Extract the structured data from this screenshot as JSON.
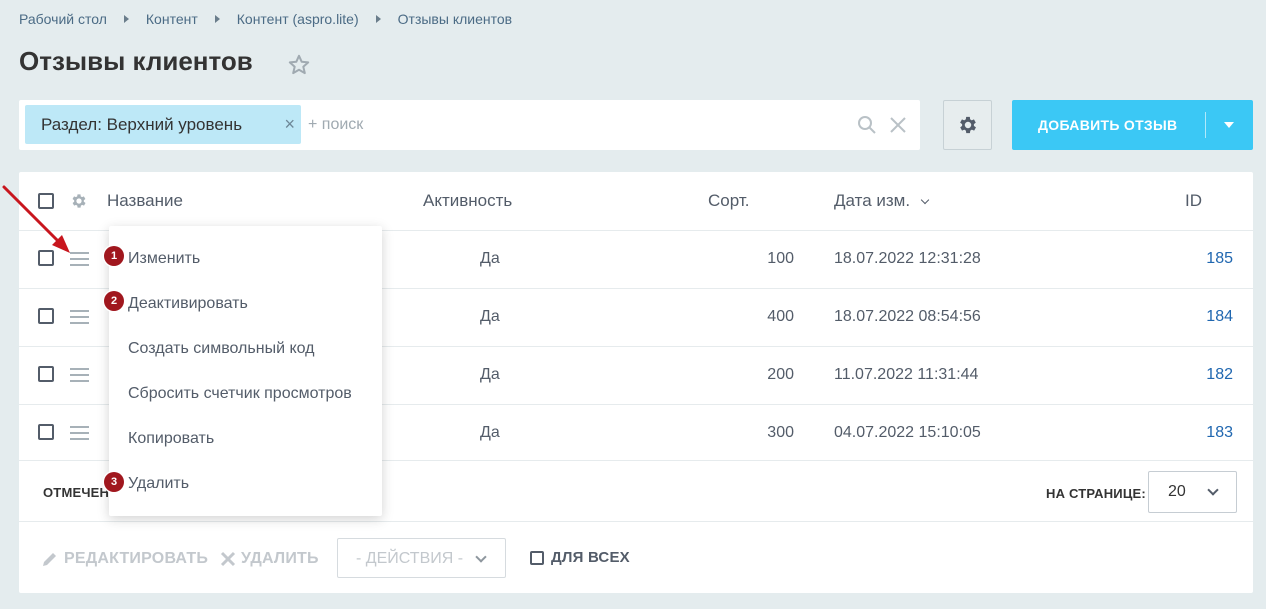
{
  "breadcrumb": [
    "Рабочий стол",
    "Контент",
    "Контент (aspro.lite)",
    "Отзывы клиентов"
  ],
  "page_title": "Отзывы клиентов",
  "filter": {
    "chip_label": "Раздел: Верхний уровень",
    "chip_close": "×",
    "search_placeholder": "+ поиск"
  },
  "add_button_label": "ДОБАВИТЬ ОТЗЫВ",
  "columns": {
    "name": "Название",
    "active": "Активность",
    "sort": "Сорт.",
    "date": "Дата изм.",
    "id": "ID"
  },
  "rows": [
    {
      "active": "Да",
      "sort": "100",
      "date": "18.07.2022 12:31:28",
      "id": "185"
    },
    {
      "active": "Да",
      "sort": "400",
      "date": "18.07.2022 08:54:56",
      "id": "184"
    },
    {
      "active": "Да",
      "sort": "200",
      "date": "11.07.2022 11:31:44",
      "id": "182"
    },
    {
      "active": "Да",
      "sort": "300",
      "date": "04.07.2022 15:10:05",
      "id": "183"
    }
  ],
  "context_menu": [
    {
      "label": "Изменить",
      "badge": "1"
    },
    {
      "label": "Деактивировать",
      "badge": "2"
    },
    {
      "label": "Создать символьный код",
      "badge": ""
    },
    {
      "label": "Сбросить счетчик просмотров",
      "badge": ""
    },
    {
      "label": "Копировать",
      "badge": ""
    },
    {
      "label": "Удалить",
      "badge": "3"
    }
  ],
  "footer": {
    "marked_label": "ОТМЕЧЕН",
    "per_page_label": "НА СТРАНИЦЕ:",
    "per_page_value": "20",
    "edit_label": "РЕДАКТИРОВАТЬ",
    "delete_label": "УДАЛИТЬ",
    "actions_label": "- ДЕЙСТВИЯ -",
    "for_all_label": "ДЛЯ ВСЕХ"
  },
  "colors": {
    "accent": "#3bc8f5",
    "chip": "#bde8f7",
    "badge": "#a0171e",
    "arrow": "#c8161e",
    "link": "#2067b0"
  }
}
